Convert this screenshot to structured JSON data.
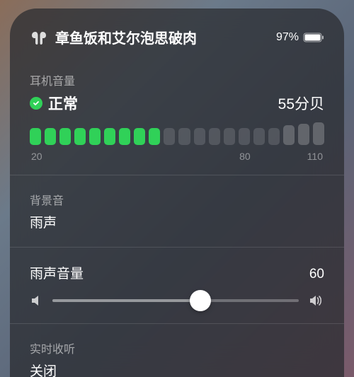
{
  "header": {
    "device_name": "章鱼饭和艾尔泡思破肉",
    "battery_pct": "97%"
  },
  "headphone": {
    "title": "耳机音量",
    "status_label": "正常",
    "db_value": "55分贝",
    "meter_segments_on": 9,
    "meter_segments_total": 20,
    "scale": {
      "min": "20",
      "mid": "80",
      "max": "110"
    }
  },
  "background_sound": {
    "title": "背景音",
    "value": "雨声"
  },
  "volume": {
    "label": "雨声音量",
    "value": "60",
    "percent": 60
  },
  "live_listen": {
    "title": "实时收听",
    "value": "关闭"
  },
  "colors": {
    "accent_green": "#30d158"
  }
}
